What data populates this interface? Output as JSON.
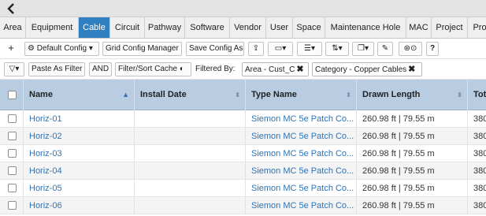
{
  "tabs": [
    "Area",
    "Equipment",
    "Cable",
    "Circuit",
    "Pathway",
    "Software",
    "Vendor",
    "User",
    "Space",
    "Maintenance Hole",
    "MAC",
    "Project",
    "Pro"
  ],
  "active_tab": "Cable",
  "accent_color": "#2f7fc1",
  "link_color": "#2b73b8",
  "toolbar": {
    "add": "+",
    "default_config": "Default Config",
    "grid_config_manager": "Grid Config Manager",
    "save_config_as": "Save Config As",
    "help": "?"
  },
  "filterbar": {
    "paste_as_filter": "Paste As Filter",
    "and": "AND",
    "filter_sort_cache": "Filter/Sort Cache",
    "filtered_by": "Filtered By:",
    "filters": [
      "Area - Cust_C",
      "Category - Copper Cables"
    ]
  },
  "grid": {
    "columns": [
      "Name",
      "Install Date",
      "Type Name",
      "Drawn Length",
      "Tota"
    ],
    "rows": [
      {
        "name": "Horiz-01",
        "install_date": "",
        "type_name": "Siemon MC 5e Patch Co...",
        "drawn_length": "260.98 ft | 79.55 m",
        "total": "380"
      },
      {
        "name": "Horiz-02",
        "install_date": "",
        "type_name": "Siemon MC 5e Patch Co...",
        "drawn_length": "260.98 ft | 79.55 m",
        "total": "380"
      },
      {
        "name": "Horiz-03",
        "install_date": "",
        "type_name": "Siemon MC 5e Patch Co...",
        "drawn_length": "260.98 ft | 79.55 m",
        "total": "380"
      },
      {
        "name": "Horiz-04",
        "install_date": "",
        "type_name": "Siemon MC 5e Patch Co...",
        "drawn_length": "260.98 ft | 79.55 m",
        "total": "380"
      },
      {
        "name": "Horiz-05",
        "install_date": "",
        "type_name": "Siemon MC 5e Patch Co...",
        "drawn_length": "260.98 ft | 79.55 m",
        "total": "380"
      },
      {
        "name": "Horiz-06",
        "install_date": "",
        "type_name": "Siemon MC 5e Patch Co...",
        "drawn_length": "260.98 ft | 79.55 m",
        "total": "380"
      }
    ]
  }
}
